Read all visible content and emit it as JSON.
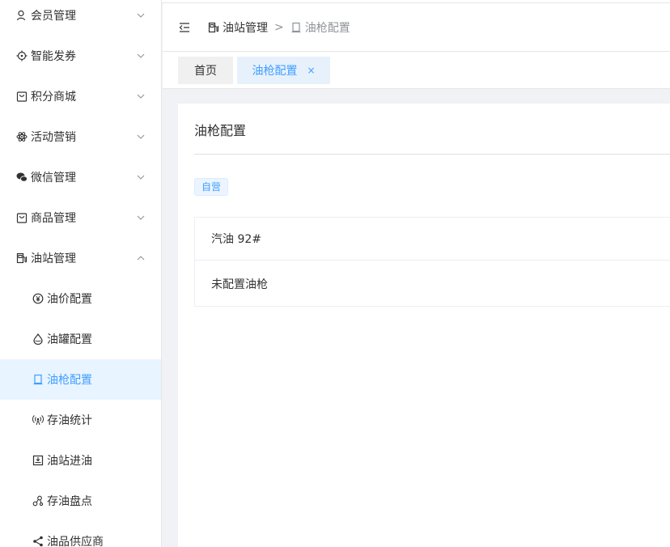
{
  "sidebar": {
    "items": [
      {
        "label": "会员管理",
        "icon": "user-icon",
        "expanded": false
      },
      {
        "label": "智能发券",
        "icon": "target-icon",
        "expanded": false
      },
      {
        "label": "积分商城",
        "icon": "bag-icon",
        "expanded": false
      },
      {
        "label": "活动营销",
        "icon": "atom-icon",
        "expanded": false
      },
      {
        "label": "微信管理",
        "icon": "wechat-icon",
        "expanded": false
      },
      {
        "label": "商品管理",
        "icon": "bag-icon",
        "expanded": false
      },
      {
        "label": "油站管理",
        "icon": "gas-station-icon",
        "expanded": true
      }
    ],
    "subitems": [
      {
        "label": "油价配置",
        "icon": "yen-circle-icon"
      },
      {
        "label": "油罐配置",
        "icon": "drop-icon"
      },
      {
        "label": "油枪配置",
        "icon": "nozzle-icon",
        "active": true
      },
      {
        "label": "存油统计",
        "icon": "signal-icon"
      },
      {
        "label": "油站进油",
        "icon": "inbox-icon"
      },
      {
        "label": "存油盘点",
        "icon": "nodes-icon"
      },
      {
        "label": "油品供应商",
        "icon": "share-icon"
      }
    ]
  },
  "header": {
    "breadcrumb": [
      {
        "label": "油站管理",
        "icon": "gas-station-icon"
      },
      {
        "label": "油枪配置",
        "icon": "nozzle-icon"
      }
    ],
    "separator": ">"
  },
  "tabs": [
    {
      "label": "首页"
    },
    {
      "label": "油枪配置",
      "close": "×",
      "active": true
    }
  ],
  "main": {
    "title": "油枪配置",
    "tag": "自营",
    "rows": [
      "汽油 92#",
      "未配置油枪"
    ]
  },
  "colors": {
    "accent": "#409eff",
    "active_bg": "#e8f4ff",
    "tag_bg": "#ecf5ff"
  }
}
